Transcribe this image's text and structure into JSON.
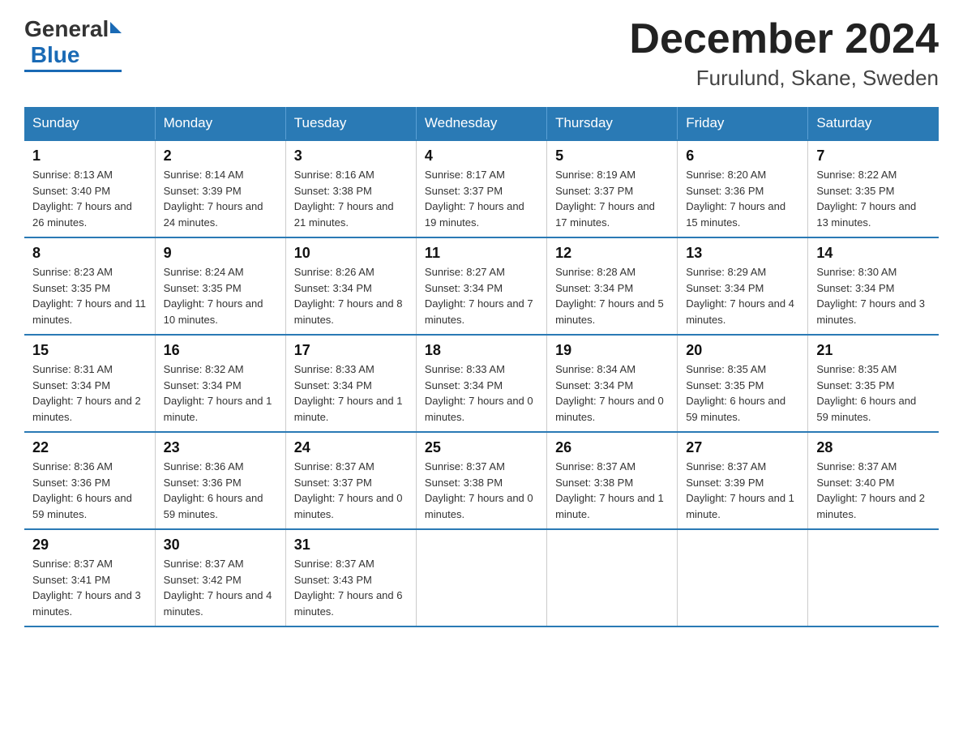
{
  "header": {
    "title": "December 2024",
    "subtitle": "Furulund, Skane, Sweden",
    "logo_general": "General",
    "logo_blue": "Blue"
  },
  "days_of_week": [
    "Sunday",
    "Monday",
    "Tuesday",
    "Wednesday",
    "Thursday",
    "Friday",
    "Saturday"
  ],
  "weeks": [
    [
      {
        "day": "1",
        "sunrise": "8:13 AM",
        "sunset": "3:40 PM",
        "daylight": "7 hours and 26 minutes."
      },
      {
        "day": "2",
        "sunrise": "8:14 AM",
        "sunset": "3:39 PM",
        "daylight": "7 hours and 24 minutes."
      },
      {
        "day": "3",
        "sunrise": "8:16 AM",
        "sunset": "3:38 PM",
        "daylight": "7 hours and 21 minutes."
      },
      {
        "day": "4",
        "sunrise": "8:17 AM",
        "sunset": "3:37 PM",
        "daylight": "7 hours and 19 minutes."
      },
      {
        "day": "5",
        "sunrise": "8:19 AM",
        "sunset": "3:37 PM",
        "daylight": "7 hours and 17 minutes."
      },
      {
        "day": "6",
        "sunrise": "8:20 AM",
        "sunset": "3:36 PM",
        "daylight": "7 hours and 15 minutes."
      },
      {
        "day": "7",
        "sunrise": "8:22 AM",
        "sunset": "3:35 PM",
        "daylight": "7 hours and 13 minutes."
      }
    ],
    [
      {
        "day": "8",
        "sunrise": "8:23 AM",
        "sunset": "3:35 PM",
        "daylight": "7 hours and 11 minutes."
      },
      {
        "day": "9",
        "sunrise": "8:24 AM",
        "sunset": "3:35 PM",
        "daylight": "7 hours and 10 minutes."
      },
      {
        "day": "10",
        "sunrise": "8:26 AM",
        "sunset": "3:34 PM",
        "daylight": "7 hours and 8 minutes."
      },
      {
        "day": "11",
        "sunrise": "8:27 AM",
        "sunset": "3:34 PM",
        "daylight": "7 hours and 7 minutes."
      },
      {
        "day": "12",
        "sunrise": "8:28 AM",
        "sunset": "3:34 PM",
        "daylight": "7 hours and 5 minutes."
      },
      {
        "day": "13",
        "sunrise": "8:29 AM",
        "sunset": "3:34 PM",
        "daylight": "7 hours and 4 minutes."
      },
      {
        "day": "14",
        "sunrise": "8:30 AM",
        "sunset": "3:34 PM",
        "daylight": "7 hours and 3 minutes."
      }
    ],
    [
      {
        "day": "15",
        "sunrise": "8:31 AM",
        "sunset": "3:34 PM",
        "daylight": "7 hours and 2 minutes."
      },
      {
        "day": "16",
        "sunrise": "8:32 AM",
        "sunset": "3:34 PM",
        "daylight": "7 hours and 1 minute."
      },
      {
        "day": "17",
        "sunrise": "8:33 AM",
        "sunset": "3:34 PM",
        "daylight": "7 hours and 1 minute."
      },
      {
        "day": "18",
        "sunrise": "8:33 AM",
        "sunset": "3:34 PM",
        "daylight": "7 hours and 0 minutes."
      },
      {
        "day": "19",
        "sunrise": "8:34 AM",
        "sunset": "3:34 PM",
        "daylight": "7 hours and 0 minutes."
      },
      {
        "day": "20",
        "sunrise": "8:35 AM",
        "sunset": "3:35 PM",
        "daylight": "6 hours and 59 minutes."
      },
      {
        "day": "21",
        "sunrise": "8:35 AM",
        "sunset": "3:35 PM",
        "daylight": "6 hours and 59 minutes."
      }
    ],
    [
      {
        "day": "22",
        "sunrise": "8:36 AM",
        "sunset": "3:36 PM",
        "daylight": "6 hours and 59 minutes."
      },
      {
        "day": "23",
        "sunrise": "8:36 AM",
        "sunset": "3:36 PM",
        "daylight": "6 hours and 59 minutes."
      },
      {
        "day": "24",
        "sunrise": "8:37 AM",
        "sunset": "3:37 PM",
        "daylight": "7 hours and 0 minutes."
      },
      {
        "day": "25",
        "sunrise": "8:37 AM",
        "sunset": "3:38 PM",
        "daylight": "7 hours and 0 minutes."
      },
      {
        "day": "26",
        "sunrise": "8:37 AM",
        "sunset": "3:38 PM",
        "daylight": "7 hours and 1 minute."
      },
      {
        "day": "27",
        "sunrise": "8:37 AM",
        "sunset": "3:39 PM",
        "daylight": "7 hours and 1 minute."
      },
      {
        "day": "28",
        "sunrise": "8:37 AM",
        "sunset": "3:40 PM",
        "daylight": "7 hours and 2 minutes."
      }
    ],
    [
      {
        "day": "29",
        "sunrise": "8:37 AM",
        "sunset": "3:41 PM",
        "daylight": "7 hours and 3 minutes."
      },
      {
        "day": "30",
        "sunrise": "8:37 AM",
        "sunset": "3:42 PM",
        "daylight": "7 hours and 4 minutes."
      },
      {
        "day": "31",
        "sunrise": "8:37 AM",
        "sunset": "3:43 PM",
        "daylight": "7 hours and 6 minutes."
      },
      {
        "day": "",
        "sunrise": "",
        "sunset": "",
        "daylight": ""
      },
      {
        "day": "",
        "sunrise": "",
        "sunset": "",
        "daylight": ""
      },
      {
        "day": "",
        "sunrise": "",
        "sunset": "",
        "daylight": ""
      },
      {
        "day": "",
        "sunrise": "",
        "sunset": "",
        "daylight": ""
      }
    ]
  ],
  "labels": {
    "sunrise_prefix": "Sunrise: ",
    "sunset_prefix": "Sunset: ",
    "daylight_prefix": "Daylight: "
  }
}
